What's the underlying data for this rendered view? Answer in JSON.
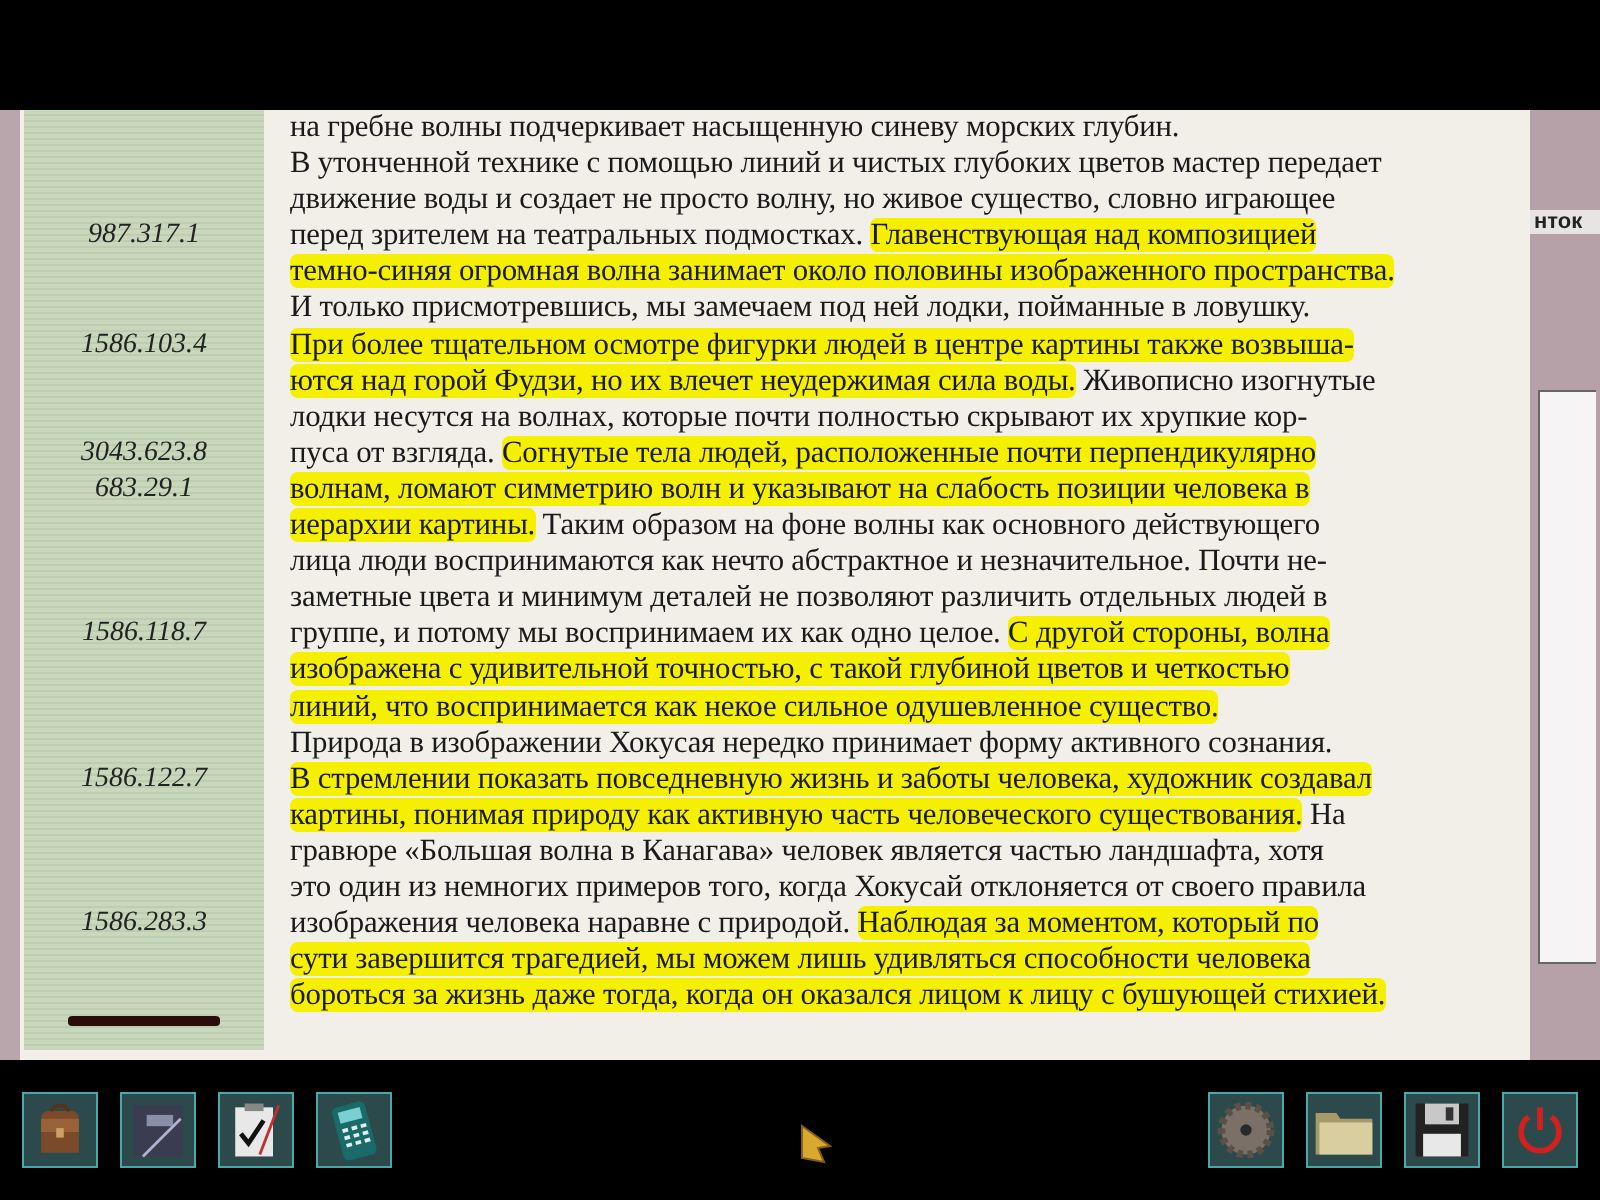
{
  "document": {
    "lines": [
      {
        "segments": [
          {
            "text": "на гребне волны подчеркивает насыщенную синеву морских глубин.",
            "highlighted": false
          }
        ]
      },
      {
        "segments": [
          {
            "text": "В утонченной технике с помощью линий и чистых глубоких цветов мастер передает",
            "highlighted": false
          }
        ]
      },
      {
        "segments": [
          {
            "text": "движение воды и создает не просто волну, но живое существо, словно играющее",
            "highlighted": false
          }
        ]
      },
      {
        "ref": "987.317.1",
        "segments": [
          {
            "text": "перед зрителем на театральных подмостках. ",
            "highlighted": false
          },
          {
            "text": "Главенствующая над композицией",
            "highlighted": true
          }
        ]
      },
      {
        "segments": [
          {
            "text": "темно-синяя огромная волна занимает около половины изображенного пространства.",
            "highlighted": true
          }
        ]
      },
      {
        "segments": [
          {
            "text": "И только присмотревшись, мы замечаем под ней лодки, пойманные в ловушку.",
            "highlighted": false
          }
        ]
      },
      {
        "ref": "1586.103.4",
        "segments": [
          {
            "text": "При более тщательном осмотре фигурки людей в центре картины также возвыша-",
            "highlighted": true
          }
        ]
      },
      {
        "segments": [
          {
            "text": "ются над горой Фудзи, но их влечет неудержимая сила воды.",
            "highlighted": true
          },
          {
            "text": " Живописно изогнутые",
            "highlighted": false
          }
        ]
      },
      {
        "segments": [
          {
            "text": "лодки несутся на волнах, которые почти полностью скрывают их хрупкие кор-",
            "highlighted": false
          }
        ]
      },
      {
        "ref": "3043.623.8",
        "segments": [
          {
            "text": "пуса от взгляда. ",
            "highlighted": false
          },
          {
            "text": "Согнутые тела людей, расположенные почти перпендикулярно",
            "highlighted": true
          }
        ]
      },
      {
        "ref": "683.29.1",
        "segments": [
          {
            "text": "волнам, ломают симметрию волн и указывают на слабость позиции человека в",
            "highlighted": true
          }
        ]
      },
      {
        "segments": [
          {
            "text": "иерархии картины.",
            "highlighted": true
          },
          {
            "text": " Таким образом на фоне волны как основного действующего",
            "highlighted": false
          }
        ]
      },
      {
        "segments": [
          {
            "text": "лица люди воспринимаются как нечто абстрактное и незначительное. Почти не-",
            "highlighted": false
          }
        ]
      },
      {
        "segments": [
          {
            "text": "заметные цвета и минимум деталей не позволяют различить отдельных людей в",
            "highlighted": false
          }
        ]
      },
      {
        "ref": "1586.118.7",
        "segments": [
          {
            "text": "группе, и потому мы воспринимаем их как одно целое. ",
            "highlighted": false
          },
          {
            "text": "С другой стороны, волна",
            "highlighted": true
          }
        ]
      },
      {
        "segments": [
          {
            "text": "изображена с удивительной точностью, с такой глубиной цветов и четкостью",
            "highlighted": true
          }
        ]
      },
      {
        "segments": [
          {
            "text": "линий, что воспринимается как некое сильное одушевленное существо.",
            "highlighted": true
          }
        ]
      },
      {
        "segments": [
          {
            "text": "Природа в изображении Хокусая нередко принимает форму активного сознания.",
            "highlighted": false
          }
        ]
      },
      {
        "ref": "1586.122.7",
        "segments": [
          {
            "text": "В стремлении показать повседневную жизнь и заботы человека, художник создавал",
            "highlighted": true
          }
        ]
      },
      {
        "segments": [
          {
            "text": "картины, понимая природу как активную часть человеческого существования.",
            "highlighted": true
          },
          {
            "text": " На",
            "highlighted": false
          }
        ]
      },
      {
        "segments": [
          {
            "text": "гравюре «Большая волна в Канагава» человек является частью ландшафта, хотя",
            "highlighted": false
          }
        ]
      },
      {
        "segments": [
          {
            "text": "это один из немногих примеров того, когда Хокусай отклоняется от своего правила",
            "highlighted": false
          }
        ]
      },
      {
        "ref": "1586.283.3",
        "segments": [
          {
            "text": "изображения человека наравне с природой. ",
            "highlighted": false
          },
          {
            "text": "Наблюдая за моментом, который по",
            "highlighted": true
          }
        ]
      },
      {
        "segments": [
          {
            "text": "сути завершится трагедией, мы можем лишь удивляться способности человека",
            "highlighted": true
          }
        ]
      },
      {
        "segments": [
          {
            "text": "бороться за жизнь даже тогда, когда он оказался лицом к лицу с бушующей стихией.",
            "highlighted": true
          }
        ]
      }
    ]
  },
  "background_label": "нток",
  "toolbar": {
    "left": [
      {
        "kind": "bag"
      },
      {
        "kind": "notebook"
      },
      {
        "kind": "checklist"
      },
      {
        "kind": "phone"
      }
    ],
    "right": [
      {
        "kind": "gear"
      },
      {
        "kind": "folder"
      },
      {
        "kind": "floppy"
      },
      {
        "kind": "power"
      }
    ]
  }
}
